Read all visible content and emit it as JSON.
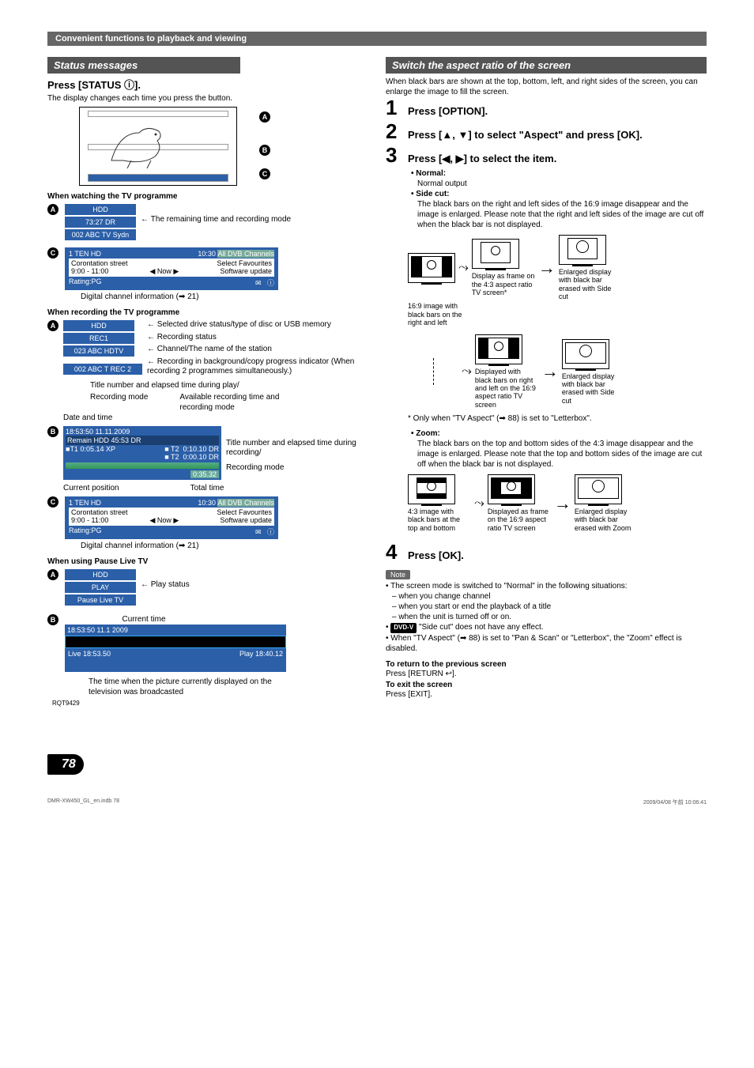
{
  "header": "Convenient functions to playback and viewing",
  "left": {
    "section_title": "Status messages",
    "press_status": "Press [STATUS ⓘ].",
    "press_status_caption": "The display changes each time you press the button.",
    "labels": {
      "A": "A",
      "B": "B",
      "C": "C"
    },
    "watching_head": "When watching the TV programme",
    "watching_A": {
      "line1": "HDD",
      "line2": "73:27 DR",
      "line3": "002 ABC TV Sydn",
      "desc": "The remaining time and recording mode"
    },
    "watching_C": {
      "row1_left": "1 TEN HD",
      "row1_right_time": "10:30",
      "row1_right_badge": "All DVB Channels",
      "row2_left": "Corontation street",
      "row2_right": "Select Favourites",
      "row3_left": "9:00 - 11:00",
      "row3_mid": "◀ Now ▶",
      "row3_right": "Software update",
      "row4_left": "Rating:PG",
      "row4_right": "i",
      "caption": "Digital channel information (➡ 21)"
    },
    "recording_head": "When recording the TV programme",
    "recording_A": {
      "line1": "HDD",
      "line2": "REC1",
      "line3": "023 ABC HDTV",
      "line4": "002 ABC T REC 2",
      "descs": {
        "d1": "Selected drive status/type of disc or USB memory",
        "d2": "Recording status",
        "d3": "Channel/The name of the station",
        "d4": "Recording in background/copy progress indicator (When recording 2 programmes simultaneously.)"
      }
    },
    "recording_B": {
      "caption_top": "Title number and elapsed time during play/",
      "label_recmode": "Recording mode",
      "label_date": "Date and time",
      "label_available": "Available recording time and recording mode",
      "ts": "18:53:50 11.11.2009",
      "remain": "Remain  HDD 45:53  DR",
      "t1": "T1    0:05.14  XP",
      "t1r": "0:10.10  DR",
      "t2": "T2",
      "t2r": "0:00.10  DR",
      "total": "0:35.32",
      "desc_right1": "Title number and elapsed time during recording/",
      "desc_right2": "Recording mode",
      "below_left": "Current position",
      "below_right": "Total time"
    },
    "pause_head": "When using Pause Live TV",
    "pause_A": {
      "line1": "HDD",
      "line2": "PLAY",
      "line3": "Pause Live TV",
      "desc": "Play status"
    },
    "pause_B": {
      "caption": "Current time",
      "ts_top": "18:53:50 11.1   2009",
      "live": "Live  18:53.50",
      "play": "Play  18:40.12",
      "below": "The time when the picture currently displayed on the television was broadcasted"
    }
  },
  "right": {
    "section_title": "Switch the aspect ratio of the screen",
    "intro": "When black bars are shown at the top, bottom, left, and right sides of the screen, you can enlarge the image to fill the screen.",
    "step1": "Press [OPTION].",
    "step2": "Press [▲, ▼] to select \"Aspect\" and press [OK].",
    "step3": "Press [◀, ▶] to select the item.",
    "normal_label": "Normal:",
    "normal_desc": "Normal output",
    "sidecut_label": "Side cut:",
    "sidecut_desc": "The black bars on the right and left sides of the 16:9 image disappear and the image is enlarged. Please note that the right and left sides of the image are cut off when the black bar is not displayed.",
    "caption_16_9_bars": "16:9 image with black bars on the right and left",
    "caption_display_43": "Display as frame on the 4:3 aspect ratio TV screen*",
    "caption_enlarged_sidecut": "Enlarged display with black bar erased with Side cut",
    "caption_blackbars_rl": "Displayed with black bars on right and left on the 16:9 aspect ratio TV screen",
    "caption_enlarged_sidecut2": "Enlarged display with black bar erased with Side cut",
    "footnote": "* Only when \"TV Aspect\" (➡ 88) is set to \"Letterbox\".",
    "zoom_label": "Zoom:",
    "zoom_desc": "The black bars on the top and bottom sides of the 4:3 image disappear and the image is enlarged. Please note that the top and bottom sides of the image are cut off when the black bar is not displayed.",
    "caption_43_bars": "4:3 image with black bars at the top and bottom",
    "caption_display_169z": "Displayed as frame on the 16:9 aspect ratio TV screen",
    "caption_enlarged_zoom": "Enlarged display with black bar erased with Zoom",
    "step4": "Press [OK].",
    "note_label": "Note",
    "note1": "The screen mode is switched to \"Normal\" in the following situations:",
    "note1a": "when you change channel",
    "note1b": "when you start or end the playback of a title",
    "note1c": "when the unit is turned off or on.",
    "note2_badge": "DVD-V",
    "note2": "\"Side cut\" does not have any effect.",
    "note3": "When \"TV Aspect\" (➡ 88) is set to \"Pan & Scan\" or \"Letterbox\", the \"Zoom\" effect is disabled.",
    "return_head": "To return to the previous screen",
    "return_text": "Press [RETURN ↩].",
    "exit_head": "To exit the screen",
    "exit_text": "Press [EXIT]."
  },
  "footer": {
    "rqt": "RQT9429",
    "page": "78",
    "file": "DMR-XW450_GL_en.indb   78",
    "date": "2009/04/08   午前 10:06:41"
  }
}
